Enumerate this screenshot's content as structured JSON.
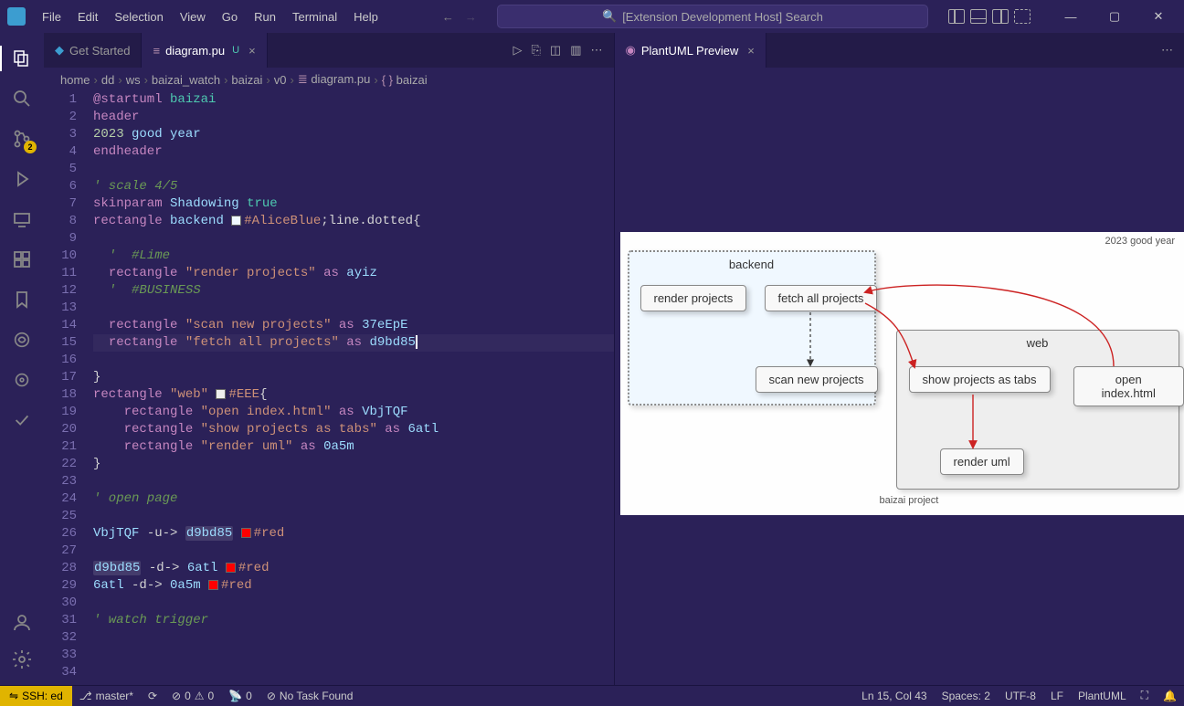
{
  "menubar": [
    "File",
    "Edit",
    "Selection",
    "View",
    "Go",
    "Run",
    "Terminal",
    "Help"
  ],
  "search_placeholder": "[Extension Development Host] Search",
  "activity": {
    "scm_badge": "2"
  },
  "tabs": {
    "left": [
      {
        "label": "Get Started",
        "active": false,
        "mod": "",
        "icon": "vscode"
      },
      {
        "label": "diagram.pu",
        "active": true,
        "mod": "U",
        "icon": "file"
      }
    ],
    "right": [
      {
        "label": "PlantUML Preview",
        "active": true,
        "icon": "preview"
      }
    ]
  },
  "breadcrumbs": [
    "home",
    "dd",
    "ws",
    "baizai_watch",
    "baizai",
    "v0",
    "diagram.pu",
    "baizai"
  ],
  "code": [
    {
      "n": 1,
      "h": "<span class='kw'>@startuml</span> <span class='type'>baizai</span>"
    },
    {
      "n": 2,
      "h": "<span class='kw'>header</span>"
    },
    {
      "n": 3,
      "h": "<span class='num'>2023</span> <span class='name'>good</span> <span class='name'>year</span>"
    },
    {
      "n": 4,
      "h": "<span class='kw'>endheader</span>"
    },
    {
      "n": 5,
      "h": ""
    },
    {
      "n": 6,
      "h": "<span class='com'>' scale 4/5</span>"
    },
    {
      "n": 7,
      "h": "<span class='kw'>skinparam</span> <span class='name'>Shadowing</span> <span class='type'>true</span>"
    },
    {
      "n": 8,
      "h": "<span class='kw'>rectangle</span> <span class='name'>backend</span> <span class='color-chip' style='background:#f0f8ff'></span><span class='str'>#AliceBlue</span><span class='op'>;line.dotted{</span>"
    },
    {
      "n": 9,
      "h": ""
    },
    {
      "n": 10,
      "h": "  <span class='com'>'  #Lime</span>"
    },
    {
      "n": 11,
      "h": "  <span class='kw'>rectangle</span> <span class='str'>\"render projects\"</span> <span class='kw'>as</span> <span class='name'>ayiz</span>"
    },
    {
      "n": 12,
      "h": "  <span class='com'>'  #BUSINESS</span>"
    },
    {
      "n": 13,
      "h": ""
    },
    {
      "n": 14,
      "h": "  <span class='kw'>rectangle</span> <span class='str'>\"scan new projects\"</span> <span class='kw'>as</span> <span class='name'>37eEpE</span>"
    },
    {
      "n": 15,
      "h": "  <span class='kw'>rectangle</span> <span class='str'>\"fetch all projects\"</span> <span class='kw'>as</span> <span class='name'>d9bd85</span><span class='cursor'></span>",
      "active": true
    },
    {
      "n": 16,
      "h": ""
    },
    {
      "n": 17,
      "h": "<span class='op'>}</span>"
    },
    {
      "n": 18,
      "h": "<span class='kw'>rectangle</span> <span class='str'>\"web\"</span> <span class='color-chip' style='background:#eee'></span><span class='str'>#EEE</span><span class='op'>{</span>"
    },
    {
      "n": 19,
      "h": "    <span class='kw'>rectangle</span> <span class='str'>\"open index.html\"</span> <span class='kw'>as</span> <span class='name'>VbjTQF</span>"
    },
    {
      "n": 20,
      "h": "    <span class='kw'>rectangle</span> <span class='str'>\"show projects as tabs\"</span> <span class='kw'>as</span> <span class='name'>6atl</span>"
    },
    {
      "n": 21,
      "h": "    <span class='kw'>rectangle</span> <span class='str'>\"render uml\"</span> <span class='kw'>as</span> <span class='name'>0a5m</span>"
    },
    {
      "n": 22,
      "h": "<span class='op'>}</span>"
    },
    {
      "n": 23,
      "h": ""
    },
    {
      "n": 24,
      "h": "<span class='com'>' open page</span>"
    },
    {
      "n": 25,
      "h": ""
    },
    {
      "n": 26,
      "h": "<span class='name'>VbjTQF</span> <span class='op'>-u-&gt;</span> <span class='name hl'>d9bd85</span> <span class='color-chip' style='background:red'></span><span class='str'>#red</span>"
    },
    {
      "n": 27,
      "h": ""
    },
    {
      "n": 28,
      "h": "<span class='name hl'>d9bd85</span> <span class='op'>-d-&gt;</span> <span class='name'>6atl</span> <span class='color-chip' style='background:red'></span><span class='str'>#red</span>"
    },
    {
      "n": 29,
      "h": "<span class='name'>6atl</span> <span class='op'>-d-&gt;</span> <span class='name'>0a5m</span> <span class='color-chip' style='background:red'></span><span class='str'>#red</span>"
    },
    {
      "n": 30,
      "h": ""
    },
    {
      "n": 31,
      "h": "<span class='com'>' watch trigger</span>"
    },
    {
      "n": 32,
      "h": ""
    },
    {
      "n": 33,
      "h": ""
    },
    {
      "n": 34,
      "h": ""
    }
  ],
  "preview": {
    "header_text": "2023 good year",
    "backend_label": "backend",
    "web_label": "web",
    "boxes": {
      "render_projects": "render projects",
      "fetch_all": "fetch all projects",
      "scan_new": "scan new projects",
      "show_tabs": "show projects as tabs",
      "open_index": "open index.html",
      "render_uml": "render uml"
    },
    "footer": "baizai project"
  },
  "status": {
    "ssh": "SSH: ed",
    "branch": "master*",
    "sync": "",
    "errors": "0",
    "warnings": "0",
    "ports": "0",
    "task": "No Task Found",
    "cursor": "Ln 15, Col 43",
    "spaces": "Spaces: 2",
    "encoding": "UTF-8",
    "eol": "LF",
    "lang": "PlantUML"
  }
}
